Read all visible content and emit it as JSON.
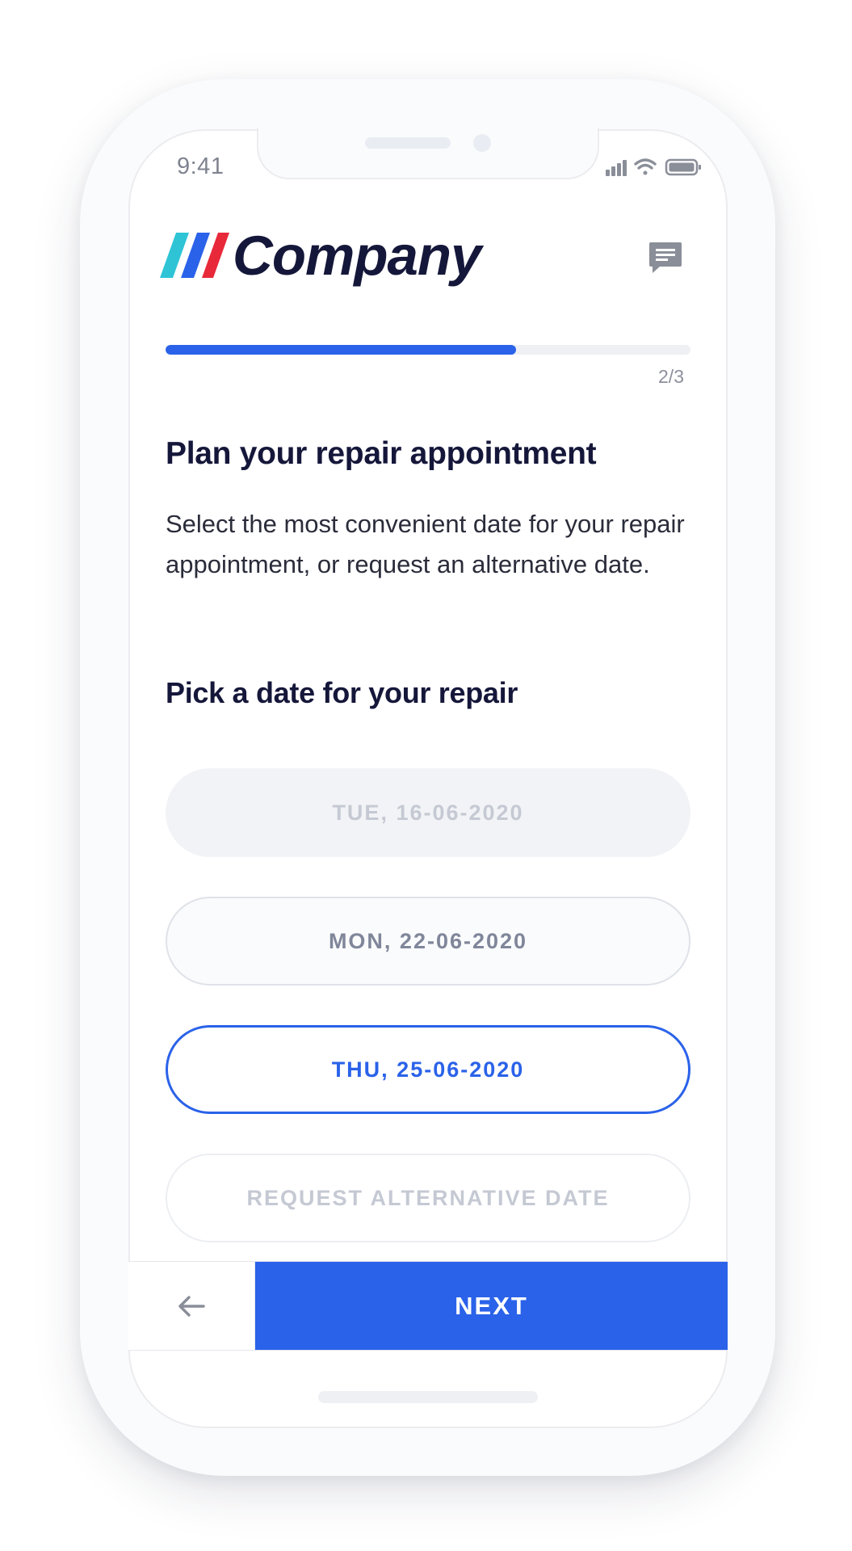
{
  "status_bar": {
    "time": "9:41",
    "icons": [
      "signal-icon",
      "wifi-icon",
      "battery-icon"
    ]
  },
  "header": {
    "brand_name": "Company",
    "brand_colors": [
      "#2ec4d6",
      "#2a62e9",
      "#e8293a"
    ],
    "chat_icon": "chat-icon"
  },
  "progress": {
    "label": "2/3",
    "fraction": 0.667,
    "color": "#2a62e9"
  },
  "main": {
    "title": "Plan your repair appointment",
    "description": "Select the most convenient date for your repair appointment, or request an alternative date.",
    "subtitle": "Pick a date for  your repair"
  },
  "date_options": [
    {
      "label": "TUE, 16-06-2020",
      "state": "disabled"
    },
    {
      "label": "MON, 22-06-2020",
      "state": "available"
    },
    {
      "label": "THU, 25-06-2020",
      "state": "selected"
    },
    {
      "label": "REQUEST ALTERNATIVE DATE",
      "state": "faded"
    }
  ],
  "footer": {
    "back_icon": "arrow-left-icon",
    "next_label": "NEXT"
  },
  "colors": {
    "accent": "#2a62e9",
    "title_text": "#15173a",
    "muted": "#80869a"
  }
}
